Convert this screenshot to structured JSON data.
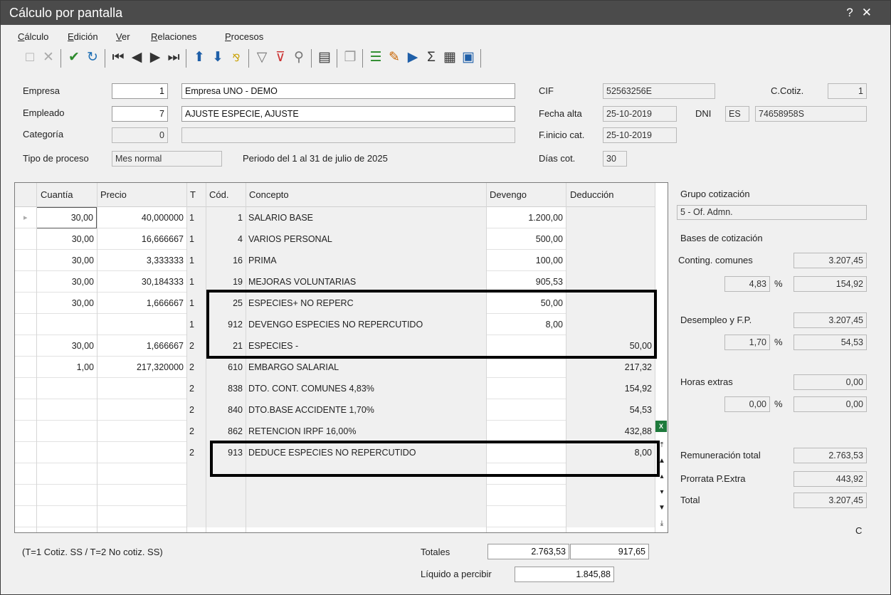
{
  "window": {
    "title": "Cálculo por pantalla",
    "help": "?",
    "close": "✕"
  },
  "menu": [
    "Cálculo",
    "Edición",
    "Ver",
    "Relaciones",
    "Procesos"
  ],
  "toolbar_icons": [
    "new-icon",
    "delete-icon",
    "accept-icon",
    "undo-icon",
    "first-icon",
    "prev-icon",
    "next-icon",
    "last-icon",
    "move-up-icon",
    "move-down-icon",
    "sort-icon",
    "filter-icon",
    "clear-filter-icon",
    "search-icon",
    "table-icon",
    "copy-icon",
    "list-icon",
    "edit-icon",
    "run-icon",
    "sum-icon",
    "report-icon",
    "preview-icon"
  ],
  "header": {
    "empresa_label": "Empresa",
    "empresa_code": "1",
    "empresa_name": "Empresa UNO - DEMO",
    "empleado_label": "Empleado",
    "empleado_code": "7",
    "empleado_name": "AJUSTE ESPECIE, AJUSTE",
    "categoria_label": "Categoría",
    "categoria_code": "0",
    "categoria_name": "",
    "tipo_label": "Tipo de proceso",
    "tipo_value": "Mes normal",
    "periodo": "Periodo del 1 al 31 de julio de 2025",
    "cif_label": "CIF",
    "cif_value": "52563256E",
    "ccotiz_label": "C.Cotiz.",
    "ccotiz_value": "1",
    "fecha_alta_label": "Fecha alta",
    "fecha_alta_value": "25-10-2019",
    "dni_label": "DNI",
    "dni_prefix": "ES",
    "dni_value": "74658958S",
    "finicio_label": "F.inicio cat.",
    "finicio_value": "25-10-2019",
    "dias_label": "Días cot.",
    "dias_value": "30"
  },
  "grid": {
    "columns": [
      "Cuantía",
      "Precio",
      "T",
      "Cód.",
      "Concepto",
      "Devengo",
      "Deducción"
    ],
    "rows": [
      [
        "30,00",
        "40,000000",
        "1",
        "1",
        "SALARIO BASE",
        "1.200,00",
        ""
      ],
      [
        "30,00",
        "16,666667",
        "1",
        "4",
        "VARIOS PERSONAL",
        "500,00",
        ""
      ],
      [
        "30,00",
        "3,333333",
        "1",
        "16",
        "PRIMA",
        "100,00",
        ""
      ],
      [
        "30,00",
        "30,184333",
        "1",
        "19",
        "MEJORAS VOLUNTARIAS",
        "905,53",
        ""
      ],
      [
        "30,00",
        "1,666667",
        "1",
        "25",
        "ESPECIES+ NO REPERC",
        "50,00",
        ""
      ],
      [
        "",
        "",
        "1",
        "912",
        "DEVENGO ESPECIES NO REPERCUTIDO",
        "8,00",
        ""
      ],
      [
        "30,00",
        "1,666667",
        "2",
        "21",
        "ESPECIES -",
        "",
        "50,00"
      ],
      [
        "1,00",
        "217,320000",
        "2",
        "610",
        "EMBARGO SALARIAL",
        "",
        "217,32"
      ],
      [
        "",
        "",
        "2",
        "838",
        "DTO. CONT. COMUNES 4,83%",
        "",
        "154,92"
      ],
      [
        "",
        "",
        "2",
        "840",
        "DTO.BASE ACCIDENTE 1,70%",
        "",
        "54,53"
      ],
      [
        "",
        "",
        "2",
        "862",
        "RETENCION IRPF    16,00%",
        "",
        "432,88"
      ],
      [
        "",
        "",
        "2",
        "913",
        "DEDUCE ESPECIES NO REPERCUTIDO",
        "",
        "8,00"
      ],
      [
        "",
        "",
        "",
        "",
        "",
        "",
        ""
      ],
      [
        "",
        "",
        "",
        "",
        "",
        "",
        ""
      ],
      [
        "",
        "",
        "",
        "",
        "",
        "",
        ""
      ]
    ]
  },
  "right": {
    "grupo_label": "Grupo cotización",
    "grupo_value": "5 - Of. Admn.",
    "bases_label": "Bases de cotización",
    "contingencias_label": "Conting. comunes",
    "contingencias_value": "3.207,45",
    "cc_pct": "4,83",
    "cc_amount": "154,92",
    "desempleo_label": "Desempleo y F.P.",
    "desempleo_value": "3.207,45",
    "de_pct": "1,70",
    "de_amount": "54,53",
    "horas_label": "Horas extras",
    "horas_value": "0,00",
    "he_pct": "0,00",
    "he_amount": "0,00",
    "pct_sign": "%",
    "remuneracion_label": "Remuneración total",
    "remuneracion_value": "2.763,53",
    "prorrata_label": "Prorrata P.Extra",
    "prorrata_value": "443,92",
    "total_label": "Total",
    "total_value": "3.207,45",
    "c_mark": "C"
  },
  "footer": {
    "legend": "(T=1 Cotiz. SS / T=2 No cotiz. SS)",
    "totales_label": "Totales",
    "totales_devengo": "2.763,53",
    "totales_deduccion": "917,65",
    "liquido_label": "Líquido a percibir",
    "liquido_value": "1.845,88"
  },
  "colors": {
    "titlebar": "#4b4b4b",
    "accept": "#2e8b2e",
    "undo": "#1f6fb5",
    "move": "#1f5fa8",
    "highlight": "#000000"
  }
}
